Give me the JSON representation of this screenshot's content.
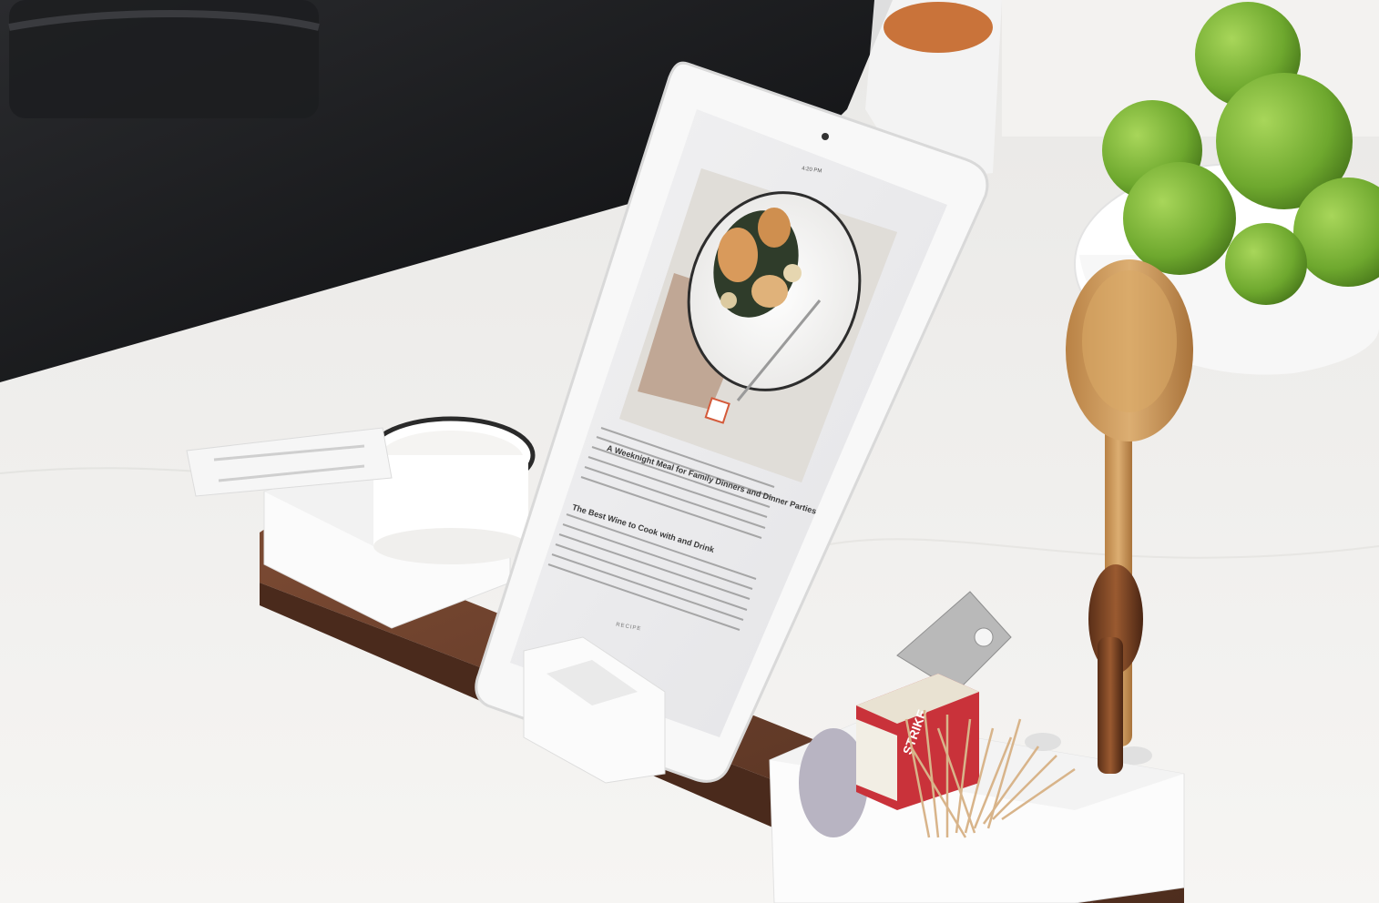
{
  "photo": {
    "tablet_screen": {
      "status_time": "4:20 PM",
      "article_heading": "A Weeknight Meal for Family Dinners and Dinner Parties",
      "article_subheading": "The Best Wine to Cook with and Drink",
      "footer_label": "RECIPE"
    },
    "matchbox_label": "STRIKE"
  },
  "colors": {
    "countertop": "#f1f0ee",
    "stovetop": "#111214",
    "walnut_tray": "#6a3f2a",
    "tablet_frame": "#f7f7f7",
    "limes": "#7db83a",
    "wooden_spoon": "#d2a064"
  }
}
